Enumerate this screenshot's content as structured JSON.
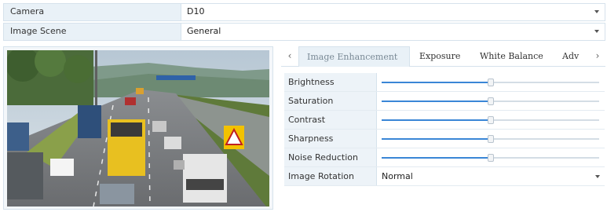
{
  "camera": {
    "label": "Camera",
    "value": "D10"
  },
  "scene": {
    "label": "Image Scene",
    "value": "General"
  },
  "preview": {
    "description_icon": "video-preview"
  },
  "tabs": {
    "prev_icon": "chevron-left-icon",
    "next_icon": "chevron-right-icon",
    "items": [
      {
        "label": "Image Enhancement",
        "active": true
      },
      {
        "label": "Exposure",
        "active": false
      },
      {
        "label": "White Balance",
        "active": false
      },
      {
        "label": "Adv",
        "active": false
      }
    ]
  },
  "settings": {
    "brightness": {
      "label": "Brightness",
      "level_percent": 50
    },
    "saturation": {
      "label": "Saturation",
      "level_percent": 50
    },
    "contrast": {
      "label": "Contrast",
      "level_percent": 50
    },
    "sharpness": {
      "label": "Sharpness",
      "level_percent": 50
    },
    "noise_reduction": {
      "label": "Noise Reduction",
      "level_percent": 50
    },
    "image_rotation": {
      "label": "Image Rotation",
      "value": "Normal"
    }
  },
  "colors": {
    "accent": "#3a86d6",
    "label_bg": "#e9f1f7",
    "border": "#d6e2ec"
  }
}
